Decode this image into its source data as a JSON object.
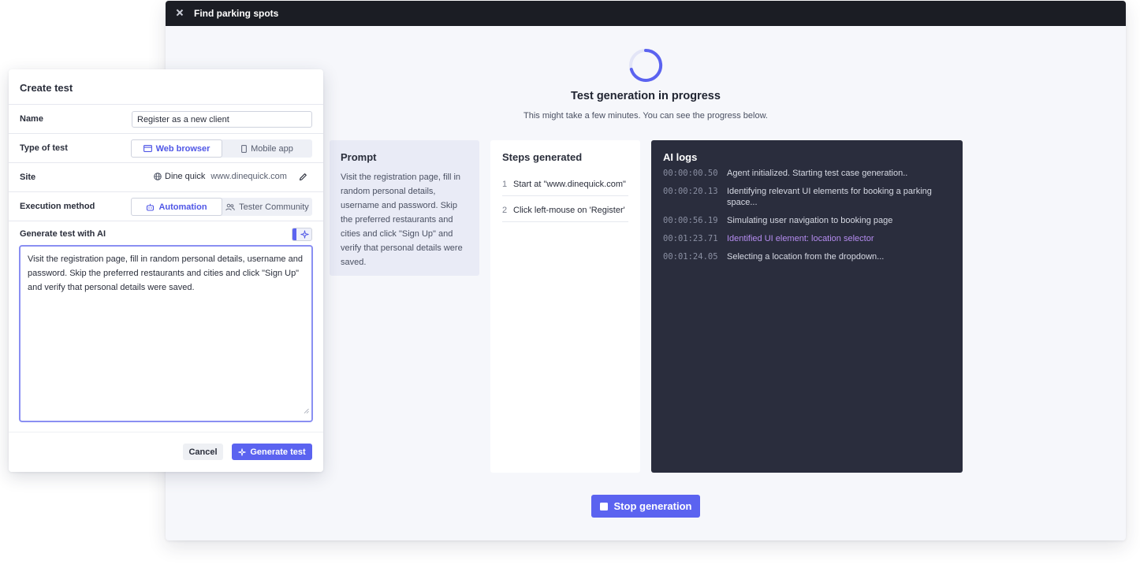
{
  "window": {
    "title": "Find parking spots",
    "progress_title": "Test generation in progress",
    "progress_subtitle": "This might take a few minutes. You can see the progress below."
  },
  "prompt_card": {
    "title": "Prompt",
    "text": "Visit the registration page, fill in random personal details, username and password. Skip the preferred restaurants and cities and click \"Sign Up\" and verify that personal details were saved."
  },
  "steps_card": {
    "title": "Steps generated",
    "steps": [
      {
        "num": "1",
        "text": "Start at \"www.dinequick.com\""
      },
      {
        "num": "2",
        "text": "Click left-mouse on 'Register'"
      }
    ]
  },
  "logs_card": {
    "title": "AI logs",
    "entries": [
      {
        "time": "00:00:00.50",
        "message": "Agent initialized. Starting test case generation.."
      },
      {
        "time": "00:00:20.13",
        "message": "Identifying relevant UI elements for booking a parking space..."
      },
      {
        "time": "00:00:56.19",
        "message": "Simulating user navigation to booking page"
      },
      {
        "time": "00:01:23.71",
        "message": "Identified UI element: location selector",
        "highlight": true
      },
      {
        "time": "00:01:24.05",
        "message": "Selecting a location from the dropdown..."
      }
    ]
  },
  "stop_button": {
    "label": "Stop generation"
  },
  "create_test": {
    "title": "Create test",
    "name_label": "Name",
    "name_value": "Register as a new client",
    "type_label": "Type of test",
    "type_options": [
      "Web browser",
      "Mobile app"
    ],
    "type_selected": "Web browser",
    "site_label": "Site",
    "site_name": "Dine quick",
    "site_url": "www.dinequick.com",
    "execution_label": "Execution method",
    "execution_options": [
      "Automation",
      "Tester Community"
    ],
    "execution_selected": "Automation",
    "generate_ai_label": "Generate test with AI",
    "prompt_value": "Visit the registration page, fill in random personal details, username and password. Skip the preferred restaurants and cities and click \"Sign Up\" and verify that personal details were saved.",
    "cancel_label": "Cancel",
    "generate_label": "Generate test"
  },
  "colors": {
    "accent": "#5b63f0",
    "titlebar": "#1b1d24",
    "logs_bg": "#2a2d3d",
    "log_highlight": "#b58cf0"
  },
  "icons": [
    "close-icon",
    "spinner-icon",
    "browser-icon",
    "mobile-icon",
    "globe-icon",
    "pencil-icon",
    "robot-icon",
    "people-icon",
    "sparkle-icon",
    "stop-icon"
  ]
}
